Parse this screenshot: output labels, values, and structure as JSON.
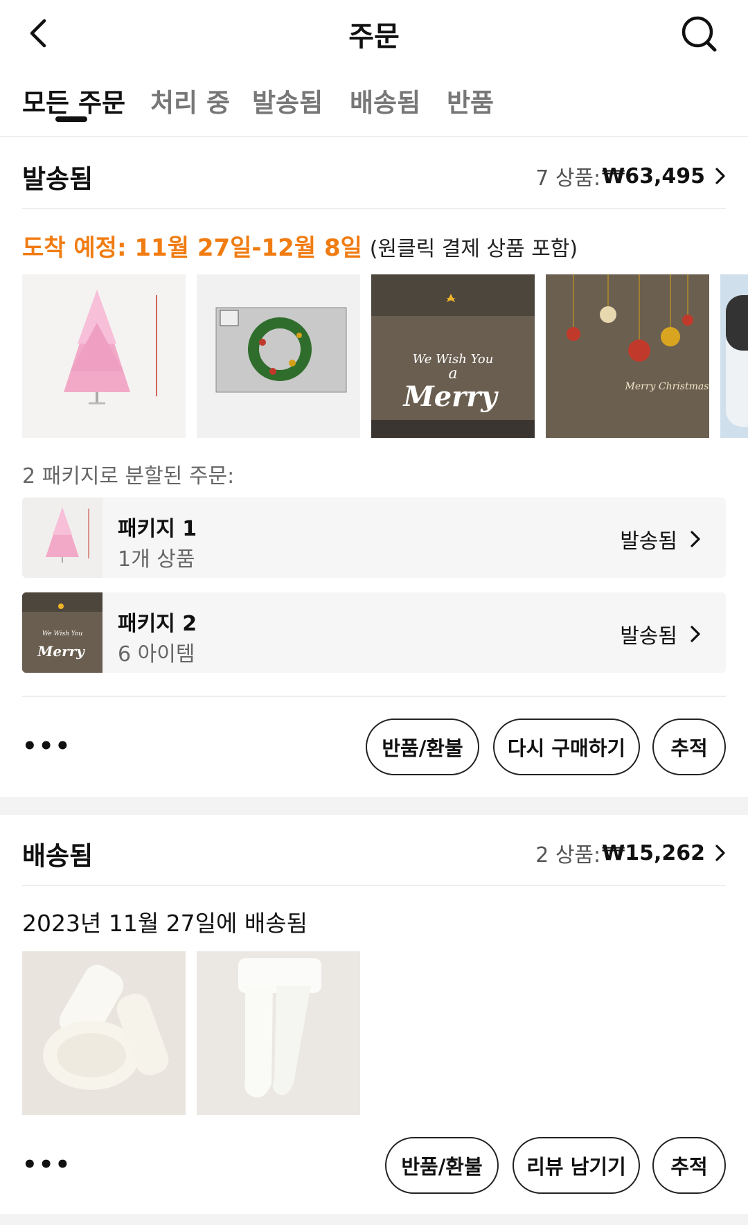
{
  "header": {
    "title": "주문"
  },
  "tabs": [
    {
      "label": "모든 주문"
    },
    {
      "label": "처리 중"
    },
    {
      "label": "발송됨"
    },
    {
      "label": "배송됨"
    },
    {
      "label": "반품"
    }
  ],
  "order1": {
    "status": "발송됨",
    "summary_count": "7 상품:",
    "summary_price": "₩63,495",
    "eta_prefix": "도착 예정: 11월 27일-12월 8일",
    "eta_note": "(원클릭 결제 상품 포함)",
    "split_label": "2 패키지로 분할된 주문:",
    "packages": [
      {
        "name": "패키지 1",
        "count": "1개 상품",
        "status": "발송됨"
      },
      {
        "name": "패키지 2",
        "count": "6 아이템",
        "status": "발송됨"
      }
    ],
    "more": "•••",
    "actions": {
      "refund": "반품/환불",
      "rebuy": "다시 구매하기",
      "track": "추적"
    }
  },
  "order2": {
    "status": "배송됨",
    "summary_count": "2 상품:",
    "summary_price": "₩15,262",
    "delivered_text": "2023년 11월 27일에 배송됨",
    "more": "•••",
    "actions": {
      "refund": "반품/환불",
      "review": "리뷰 남기기",
      "track": "추적"
    }
  }
}
